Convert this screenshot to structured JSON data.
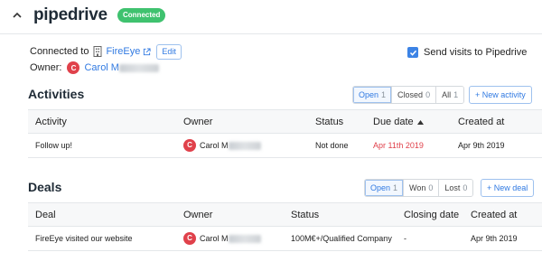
{
  "header": {
    "brand": "pipedrive",
    "status_badge": "Connected",
    "collapse_icon": "chevron-up-icon"
  },
  "connection": {
    "label": "Connected to",
    "org_icon": "building-icon",
    "org_name": "FireEye",
    "external_icon": "external-link-icon",
    "edit_label": "Edit"
  },
  "owner": {
    "label": "Owner:",
    "initial": "C",
    "name": "Carol M",
    "avatar_color": "#e0414b"
  },
  "send_visits": {
    "label": "Send visits to Pipedrive",
    "checked": true
  },
  "activities": {
    "title": "Activities",
    "filters": [
      {
        "label": "Open",
        "count": "1",
        "active": true
      },
      {
        "label": "Closed",
        "count": "0",
        "active": false
      },
      {
        "label": "All",
        "count": "1",
        "active": false
      }
    ],
    "new_label": "+ New activity",
    "columns": [
      "Activity",
      "Owner",
      "Status",
      "Due date",
      "Created at"
    ],
    "sort_icon": "sort-ascending-icon",
    "rows": [
      {
        "activity": "Follow up!",
        "owner_initial": "C",
        "owner": "Carol M",
        "status": "Not done",
        "due_date": "Apr 11th 2019",
        "created_at": "Apr 9th 2019"
      }
    ]
  },
  "deals": {
    "title": "Deals",
    "filters": [
      {
        "label": "Open",
        "count": "1",
        "active": true
      },
      {
        "label": "Won",
        "count": "0",
        "active": false
      },
      {
        "label": "Lost",
        "count": "0",
        "active": false
      }
    ],
    "new_label": "+ New deal",
    "columns": [
      "Deal",
      "Owner",
      "Status",
      "Closing date",
      "Created at"
    ],
    "rows": [
      {
        "deal": "FireEye visited our website",
        "owner_initial": "C",
        "owner": "Carol M",
        "status": "100M€+/Qualified Company",
        "closing_date": "-",
        "created_at": "Apr 9th 2019"
      }
    ]
  },
  "colors": {
    "accent": "#317ae2",
    "connected_green": "#3fc26f",
    "overdue_red": "#e0414b"
  }
}
